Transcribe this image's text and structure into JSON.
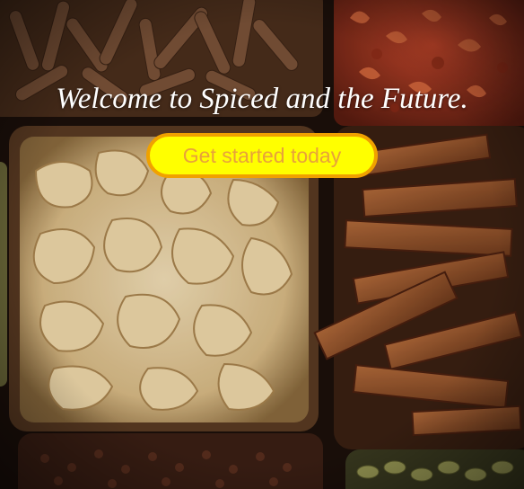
{
  "hero": {
    "headline": "Welcome to Spiced and the Future.",
    "cta_label": "Get started today",
    "background": "spice-market-baskets-photo"
  },
  "colors": {
    "cta_fill": "#ffff00",
    "cta_border": "#f0a100",
    "cta_text": "#e8a23a",
    "headline_text": "#ffffff"
  }
}
